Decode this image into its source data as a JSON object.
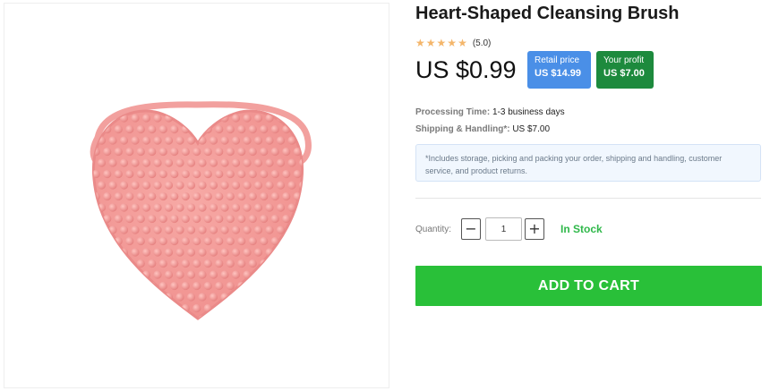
{
  "product": {
    "title": "Heart-Shaped Cleansing Brush",
    "image_icon": "heart-brush-image",
    "rating": {
      "stars": 5,
      "value_text": "(5.0)",
      "star_glyph": "★",
      "star_color": "#f4b66b"
    },
    "price": "US $0.99",
    "retail": {
      "label": "Retail price",
      "value": "US $14.99",
      "color": "#4a8fe7"
    },
    "profit": {
      "label": "Your profit",
      "value": "US $7.00",
      "color": "#1d8a3d"
    }
  },
  "details": {
    "processing_label": "Processing Time:",
    "processing_value": "1-3 business days",
    "shipping_label": "Shipping & Handling*:",
    "shipping_value": "US $7.00",
    "note": "*Includes storage, picking and packing your order, shipping and handling, customer service, and product returns."
  },
  "quantity": {
    "label": "Quantity:",
    "minus": "−",
    "plus": "+",
    "value": "1"
  },
  "stock_status": "In Stock",
  "cart_button": "ADD TO CART",
  "colors": {
    "cart": "#29c039",
    "stock": "#2fb84a",
    "product_pink": "#f39a98"
  }
}
